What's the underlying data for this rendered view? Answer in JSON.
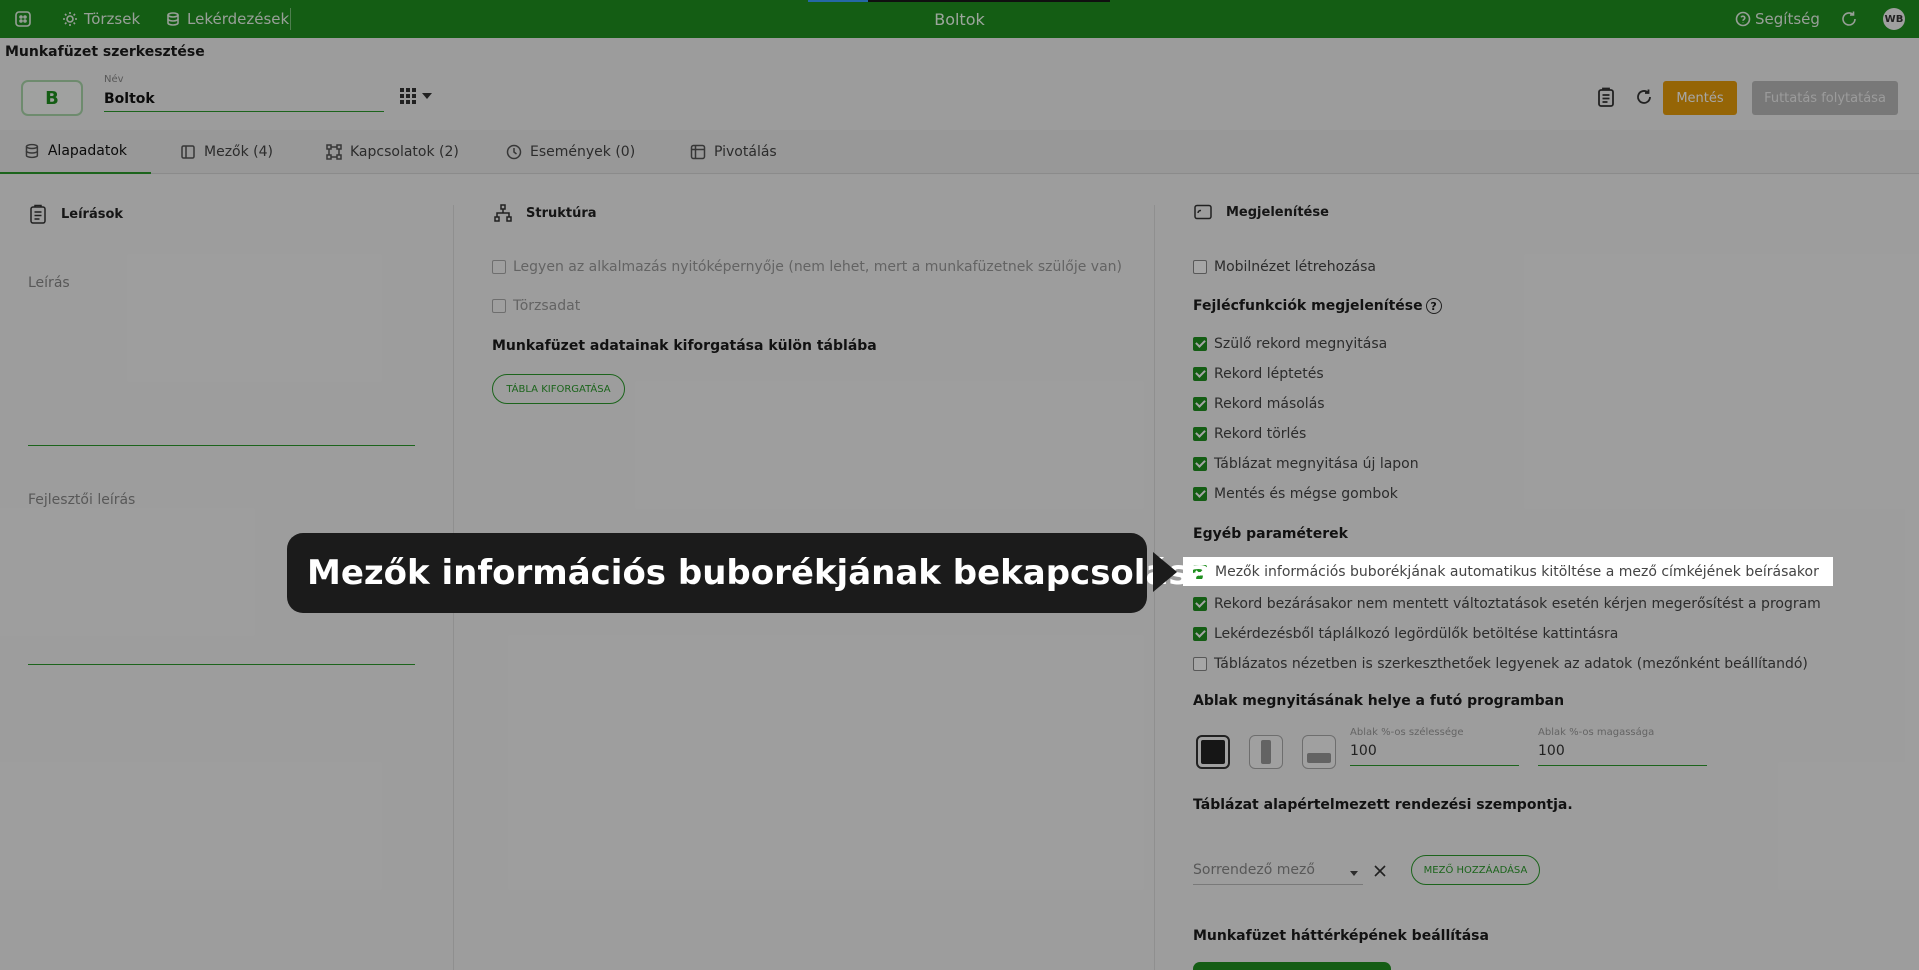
{
  "topbar": {
    "nav_torzsek": "Törzsek",
    "nav_lekerdezesek": "Lekérdezések",
    "title": "Boltok",
    "help": "Segítség",
    "avatar": "WB"
  },
  "page": {
    "title": "Munkafüzet szerkesztése"
  },
  "header": {
    "logo_letter": "B",
    "name_label": "Név",
    "name_value": "Boltok",
    "save_label": "Mentés",
    "run_label": "Futtatás folytatása"
  },
  "tabs": [
    {
      "label": "Alapadatok"
    },
    {
      "label": "Mezők (4)"
    },
    {
      "label": "Kapcsolatok (2)"
    },
    {
      "label": "Események (0)"
    },
    {
      "label": "Pivotálás"
    }
  ],
  "left": {
    "title": "Leírások",
    "desc_label": "Leírás",
    "dev_desc_label": "Fejlesztői leírás"
  },
  "middle": {
    "title": "Struktúra",
    "opt_home": "Legyen az alkalmazás nyitóképernyője (nem lehet, mert a munkafüzetnek szülője van)",
    "opt_master": "Törzsadat",
    "pivot_heading": "Munkafüzet adatainak kiforgatása külön táblába",
    "pivot_button": "TÁBLA KIFORGATÁSA"
  },
  "right": {
    "title": "Megjelenítése",
    "mobile": "Mobilnézet létrehozása",
    "header_funcs_title": "Fejlécfunkciók megjelenítése",
    "header_funcs": [
      "Szülő rekord megnyitása",
      "Rekord léptetés",
      "Rekord másolás",
      "Rekord törlés",
      "Táblázat megnyitása új lapon",
      "Mentés és mégse gombok"
    ],
    "other_title": "Egyéb paraméterek",
    "other": [
      "Mezők információs buborékjának automatikus kitöltése a mező címkéjének beírásakor",
      "Rekord bezárásakor nem mentett változtatások esetén kérjen megerősítést a program",
      "Lekérdezésből táplálkozó legördülők betöltése kattintásra",
      "Táblázatos nézetben is szerkeszthetőek legyenek az adatok (mezőnként beállítandó)"
    ],
    "window_title": "Ablak megnyitásának helye a futó programban",
    "width_label": "Ablak %-os szélessége",
    "width_value": "100",
    "height_label": "Ablak %-os magassága",
    "height_value": "100",
    "sort_title": "Táblázat alapértelmezett rendezési szempontja.",
    "sort_placeholder": "Sorrendező mező",
    "add_field_button": "MEZŐ HOZZÁADÁSA",
    "bg_title": "Munkafüzet háttérképének beállítása"
  },
  "tooltip": {
    "text": "Mezők információs buborékjának bekapcsolása"
  },
  "colors": {
    "brand": "#1f8f1f",
    "save": "#e59c0a"
  }
}
